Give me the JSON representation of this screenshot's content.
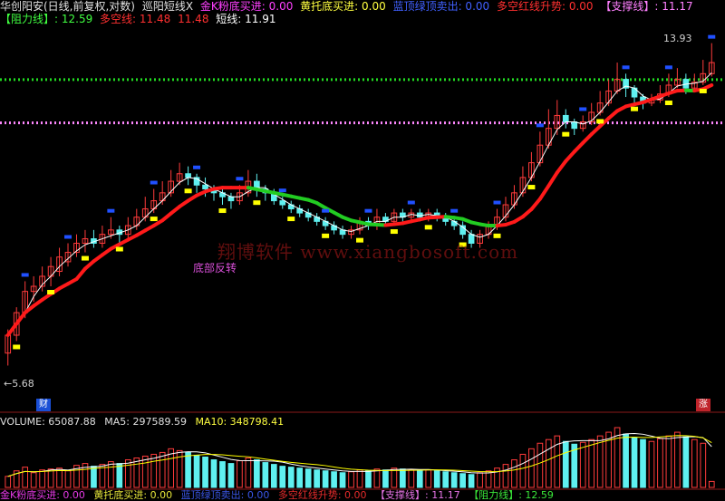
{
  "header_line1": {
    "stock": "华创阳安(日线,前复权,对数)",
    "indicator": "巡阳短线X",
    "golden_k_label": "金K粉底买进: 0.00",
    "yellow_bottom_label": "黄托底买进: 0.00",
    "blue_top_label": "蓝顶绿顶卖出: 0.00",
    "red_line_label": "多空红线升势: 0.00",
    "support_label": "【支撑线】: 11.17"
  },
  "header_line2": {
    "resistance_label": "【阻力线】: 12.59",
    "longshort_label": "多空线: 11.48",
    "longshort_value2": "11.48",
    "short_label": "短线: 11.91"
  },
  "price_labels": {
    "high": "13.93",
    "low": "5.68"
  },
  "annotation": "底部反转",
  "watermark": "翔博软件 www.xiangbosoft.com",
  "tags": {
    "left": "财",
    "right": "涨"
  },
  "volume_header": {
    "volume": "VOLUME: 65087.88",
    "ma5": "MA5: 297589.59",
    "ma10": "MA10: 348798.41"
  },
  "bottom_header_partial": {
    "a": "金K粉底买进: 0.00",
    "b": "黄托底买进: 0.00",
    "c": "蓝顶绿顶卖出: 0.00",
    "d": "多空红线升势: 0.00",
    "e": "【支撑线】: 11.17",
    "f": "【阻力线】: 12.59"
  },
  "colors": {
    "up": "#ff3b3b",
    "down": "#5ff0f0",
    "ma_red": "#ff1a1a",
    "ma_green": "#22cc22",
    "short_line": "#ffffff",
    "resistance": "#22dd22",
    "support": "#ff88ff",
    "yellow": "#ffff00",
    "blue": "#2050ff",
    "magenta": "#c040ff"
  },
  "chart_data": {
    "type": "candlestick",
    "scale": "log",
    "resistance": 12.59,
    "support": 11.17,
    "max_price": 13.93,
    "min_price": 5.68,
    "candles": [
      [
        6.2,
        5.9,
        6.3,
        5.7
      ],
      [
        6.6,
        6.2,
        6.7,
        6.1
      ],
      [
        7.0,
        6.6,
        7.2,
        6.5
      ],
      [
        7.1,
        7.0,
        7.3,
        6.8
      ],
      [
        7.3,
        7.1,
        7.5,
        7.0
      ],
      [
        7.5,
        7.3,
        7.7,
        7.1
      ],
      [
        7.7,
        7.4,
        7.9,
        7.3
      ],
      [
        7.8,
        7.6,
        8.0,
        7.5
      ],
      [
        8.0,
        7.8,
        8.2,
        7.7
      ],
      [
        8.1,
        8.0,
        8.3,
        7.8
      ],
      [
        8.0,
        8.1,
        8.3,
        7.9
      ],
      [
        8.2,
        8.0,
        8.4,
        7.9
      ],
      [
        8.3,
        8.2,
        8.6,
        8.1
      ],
      [
        8.2,
        8.3,
        8.4,
        8.0
      ],
      [
        8.4,
        8.2,
        8.6,
        8.1
      ],
      [
        8.6,
        8.4,
        8.8,
        8.3
      ],
      [
        8.8,
        8.6,
        9.1,
        8.5
      ],
      [
        9.0,
        8.8,
        9.3,
        8.7
      ],
      [
        9.2,
        9.0,
        9.5,
        8.9
      ],
      [
        9.5,
        9.2,
        9.8,
        9.1
      ],
      [
        9.7,
        9.5,
        10.0,
        9.4
      ],
      [
        9.6,
        9.7,
        9.9,
        9.4
      ],
      [
        9.4,
        9.6,
        9.7,
        9.2
      ],
      [
        9.3,
        9.4,
        9.6,
        9.1
      ],
      [
        9.2,
        9.3,
        9.4,
        9.0
      ],
      [
        9.1,
        9.2,
        9.3,
        8.9
      ],
      [
        9.0,
        9.1,
        9.2,
        8.8
      ],
      [
        9.2,
        9.0,
        9.4,
        8.9
      ],
      [
        9.5,
        9.2,
        9.8,
        9.1
      ],
      [
        9.3,
        9.5,
        9.7,
        9.1
      ],
      [
        9.2,
        9.3,
        9.4,
        9.0
      ],
      [
        9.0,
        9.2,
        9.3,
        8.9
      ],
      [
        8.9,
        9.0,
        9.1,
        8.8
      ],
      [
        8.8,
        8.9,
        9.0,
        8.7
      ],
      [
        8.7,
        8.8,
        8.9,
        8.6
      ],
      [
        8.6,
        8.7,
        8.8,
        8.5
      ],
      [
        8.5,
        8.6,
        8.7,
        8.4
      ],
      [
        8.4,
        8.5,
        8.6,
        8.3
      ],
      [
        8.3,
        8.4,
        8.5,
        8.2
      ],
      [
        8.2,
        8.3,
        8.4,
        8.1
      ],
      [
        8.3,
        8.2,
        8.4,
        8.1
      ],
      [
        8.5,
        8.3,
        8.6,
        8.2
      ],
      [
        8.4,
        8.5,
        8.6,
        8.3
      ],
      [
        8.6,
        8.4,
        8.8,
        8.3
      ],
      [
        8.5,
        8.6,
        8.7,
        8.4
      ],
      [
        8.7,
        8.5,
        8.8,
        8.4
      ],
      [
        8.6,
        8.7,
        8.8,
        8.5
      ],
      [
        8.7,
        8.6,
        8.8,
        8.5
      ],
      [
        8.6,
        8.7,
        8.8,
        8.5
      ],
      [
        8.7,
        8.6,
        8.8,
        8.5
      ],
      [
        8.6,
        8.7,
        8.8,
        8.5
      ],
      [
        8.5,
        8.6,
        8.7,
        8.4
      ],
      [
        8.4,
        8.5,
        8.6,
        8.3
      ],
      [
        8.2,
        8.4,
        8.5,
        8.1
      ],
      [
        8.0,
        8.2,
        8.3,
        7.9
      ],
      [
        8.2,
        8.0,
        8.3,
        7.9
      ],
      [
        8.4,
        8.2,
        8.5,
        8.1
      ],
      [
        8.6,
        8.4,
        8.8,
        8.3
      ],
      [
        8.9,
        8.6,
        9.1,
        8.5
      ],
      [
        9.2,
        8.9,
        9.4,
        8.8
      ],
      [
        9.6,
        9.2,
        9.9,
        9.1
      ],
      [
        10.0,
        9.6,
        10.3,
        9.5
      ],
      [
        10.5,
        10.0,
        10.9,
        9.9
      ],
      [
        11.0,
        10.5,
        11.6,
        10.4
      ],
      [
        11.4,
        11.0,
        11.9,
        10.8
      ],
      [
        11.2,
        11.4,
        11.6,
        11.0
      ],
      [
        11.0,
        11.2,
        11.3,
        10.8
      ],
      [
        11.2,
        11.0,
        11.4,
        10.9
      ],
      [
        11.5,
        11.2,
        11.8,
        11.1
      ],
      [
        11.8,
        11.5,
        12.2,
        11.4
      ],
      [
        12.2,
        11.8,
        12.6,
        11.7
      ],
      [
        12.6,
        12.2,
        13.2,
        12.1
      ],
      [
        12.3,
        12.6,
        12.8,
        12.0
      ],
      [
        12.0,
        12.3,
        12.4,
        11.8
      ],
      [
        11.8,
        12.0,
        12.1,
        11.6
      ],
      [
        11.9,
        11.8,
        12.1,
        11.7
      ],
      [
        12.1,
        11.9,
        12.4,
        11.8
      ],
      [
        12.4,
        12.1,
        12.8,
        12.0
      ],
      [
        12.6,
        12.4,
        13.0,
        12.3
      ],
      [
        12.3,
        12.6,
        12.8,
        12.1
      ],
      [
        12.5,
        12.3,
        12.8,
        12.2
      ],
      [
        12.8,
        12.5,
        13.3,
        12.4
      ],
      [
        13.2,
        12.8,
        13.93,
        12.7
      ]
    ],
    "volume": [
      120,
      180,
      220,
      160,
      190,
      200,
      210,
      180,
      240,
      260,
      230,
      250,
      280,
      260,
      300,
      320,
      340,
      360,
      380,
      420,
      400,
      380,
      350,
      330,
      300,
      280,
      260,
      290,
      320,
      300,
      270,
      250,
      230,
      220,
      210,
      200,
      190,
      180,
      170,
      160,
      170,
      190,
      180,
      200,
      190,
      210,
      200,
      190,
      180,
      190,
      180,
      170,
      160,
      150,
      140,
      160,
      180,
      210,
      250,
      300,
      360,
      420,
      480,
      520,
      560,
      500,
      470,
      490,
      520,
      560,
      600,
      650,
      580,
      540,
      520,
      500,
      530,
      560,
      600,
      550,
      520,
      480,
      65
    ]
  }
}
